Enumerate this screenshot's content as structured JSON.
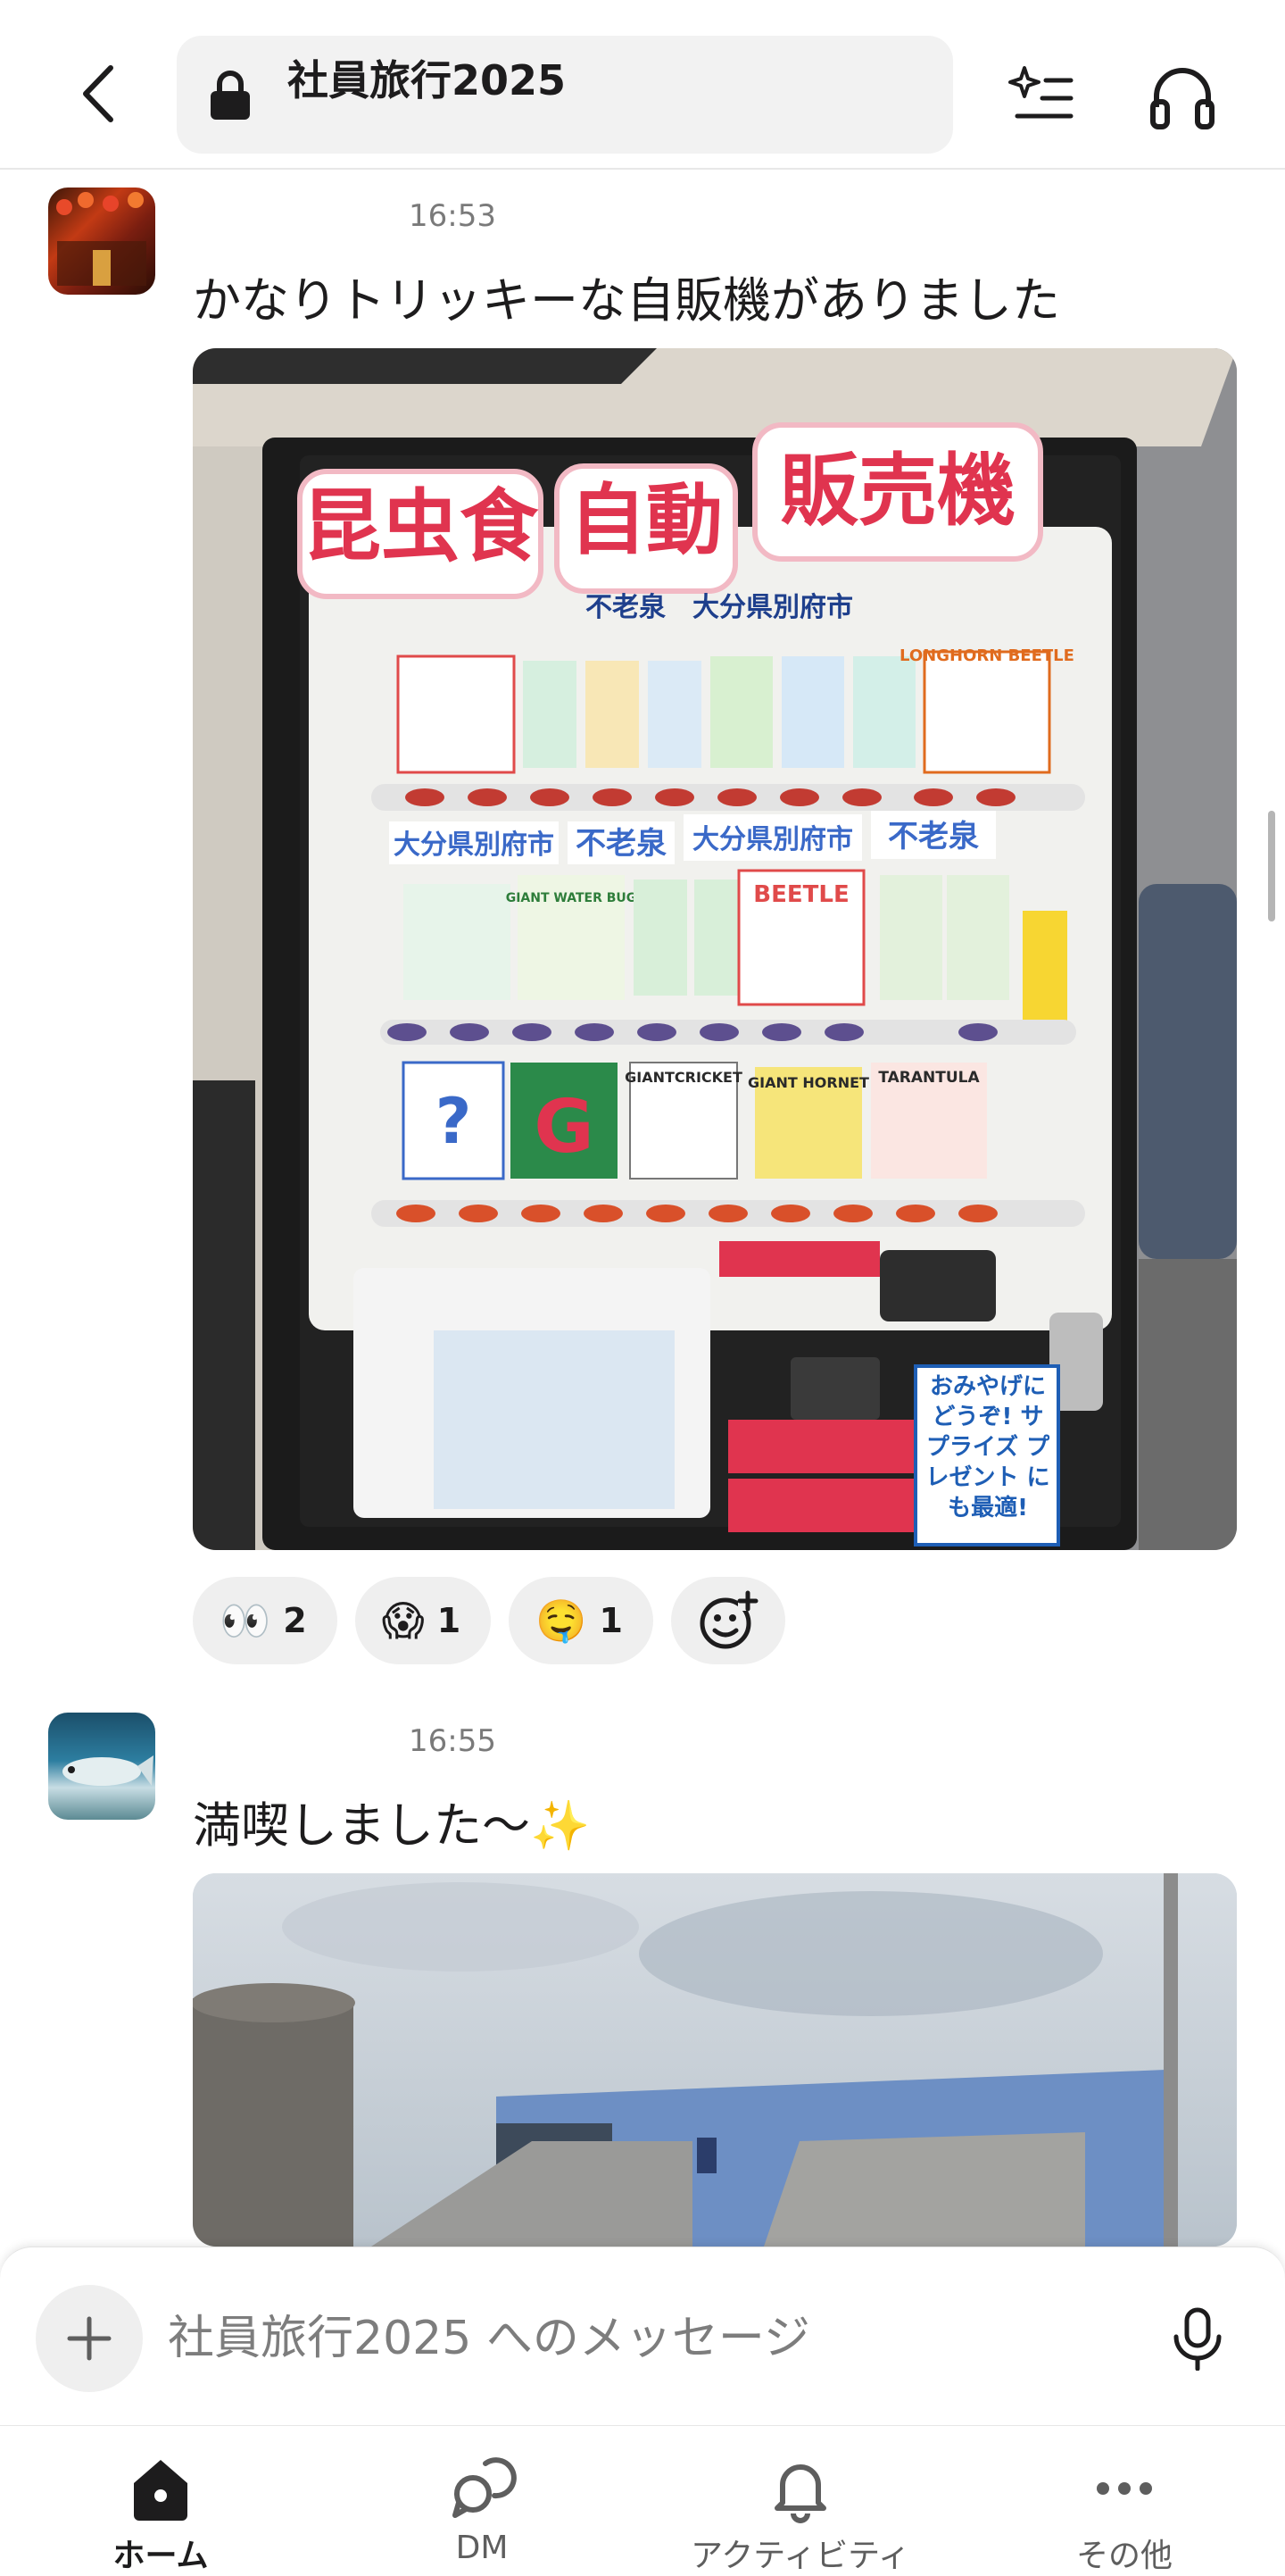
{
  "header": {
    "channel_name": "社員旅行2025",
    "icons": [
      "back-chevron-icon",
      "lock-icon",
      "summary-sparkle-icon",
      "headphones-icon"
    ]
  },
  "messages": [
    {
      "time": "16:53",
      "text": "かなりトリッキーな自販機がありました",
      "attachment": "vending-machine-photo",
      "reactions": [
        {
          "emoji": "👀",
          "count": "2"
        },
        {
          "emoji": "😱",
          "count": "1"
        },
        {
          "emoji": "🤤",
          "count": "1"
        }
      ]
    },
    {
      "time": "16:55",
      "text": "満喫しました〜✨",
      "attachment": "building-photo"
    }
  ],
  "photo1": {
    "sign_1": "昆虫食",
    "sign_2": "自動",
    "sign_3": "販売機",
    "location": "不老泉　大分県別府市",
    "strip_1": "大分県別府市",
    "strip_2": "不老泉",
    "strip_3": "大分県別府市",
    "strip_4": "不老泉",
    "prod_longhorn": "LONGHORN BEETLE",
    "prod_beetle": "BEETLE",
    "prod_giantcricket": "GIANTCRICKET",
    "prod_hornet": "GIANT HORNET",
    "prod_tarantula": "TARANTULA",
    "prod_waterbug": "GIANT WATER BUG",
    "note": "おみやげに どうぞ! サプライズ プレゼント にも最適!"
  },
  "composer": {
    "placeholder": "社員旅行2025 へのメッセージ"
  },
  "nav": {
    "home": "ホーム",
    "dm": "DM",
    "activity": "アクティビティ",
    "more": "その他"
  },
  "colors": {
    "sign_pink": "#e0344f",
    "machine_black": "#1b1b1b",
    "panel_blue": "#3a69c8"
  }
}
